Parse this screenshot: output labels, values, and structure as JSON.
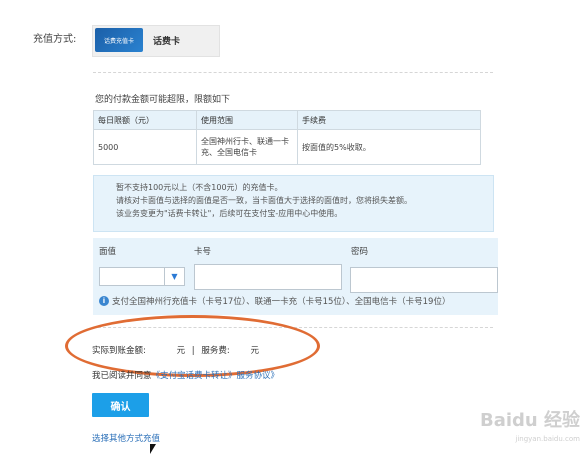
{
  "recharge": {
    "method_label": "充值方式:",
    "card_image_text": "话费充值卡",
    "card_name": "话费卡"
  },
  "limits": {
    "note": "您的付款金额可能超限，限额如下",
    "headers": [
      "每日限额（元）",
      "使用范围",
      "手续费"
    ],
    "row": {
      "daily_limit": "5000",
      "scope": "全国神州行卡、联通一卡充、全国电信卡",
      "fee": "按面值的5%收取。"
    }
  },
  "info": {
    "line1": "暂不支持100元以上（不含100元）的充值卡。",
    "line2": "请核对卡面值与选择的面值是否一致，当卡面值大于选择的面值时，您将损失差额。",
    "line3": "该业务变更为\"话费卡转让\"，后续可在支付宝-应用中心中使用。"
  },
  "form": {
    "face_value_label": "面值",
    "card_number_label": "卡号",
    "password_label": "密码",
    "face_value_selected": "",
    "card_number_value": "",
    "password_value": "",
    "support_text": "支付全国神州行充值卡（卡号17位）、联通一卡充（卡号15位）、全国电信卡（卡号19位）"
  },
  "summary": {
    "actual_amount_label": "实际到账金额:",
    "actual_amount_unit": "元",
    "separator": "|",
    "service_fee_label": "服务费:",
    "service_fee_unit": "元"
  },
  "agreement": {
    "prefix": "我已阅读并同意",
    "link_text": "《支付宝话费卡转让》服务协议》"
  },
  "actions": {
    "confirm_label": "确认",
    "other_method_label": "选择其他方式充值"
  },
  "watermark": {
    "brand": "Baidu 经验",
    "domain": "jingyan.baidu.com"
  },
  "colors": {
    "accent": "#1c9fe8",
    "link": "#2a6fb8",
    "highlight_ellipse": "#e06c34",
    "info_bg": "#e7f3fb"
  }
}
